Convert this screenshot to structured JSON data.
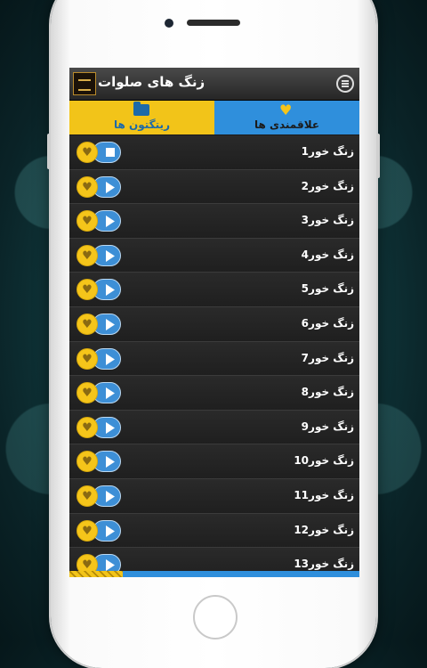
{
  "app": {
    "title": "زنگ های صلوات"
  },
  "tabs": [
    {
      "label": "ریتگتون ها",
      "icon": "folder-icon",
      "color": "#f2c419"
    },
    {
      "label": "علاقمندی ها",
      "icon": "heart-icon",
      "color": "#2f8fdc"
    }
  ],
  "ringtones": [
    {
      "label": "زنگ خور1",
      "state": "playing"
    },
    {
      "label": "زنگ خور2",
      "state": "stopped"
    },
    {
      "label": "زنگ خور3",
      "state": "stopped"
    },
    {
      "label": "زنگ خور4",
      "state": "stopped"
    },
    {
      "label": "زنگ خور5",
      "state": "stopped"
    },
    {
      "label": "زنگ خور6",
      "state": "stopped"
    },
    {
      "label": "زنگ خور7",
      "state": "stopped"
    },
    {
      "label": "زنگ خور8",
      "state": "stopped"
    },
    {
      "label": "زنگ خور9",
      "state": "stopped"
    },
    {
      "label": "زنگ خور10",
      "state": "stopped"
    },
    {
      "label": "زنگ خور11",
      "state": "stopped"
    },
    {
      "label": "زنگ خور12",
      "state": "stopped"
    },
    {
      "label": "زنگ خور13",
      "state": "stopped"
    }
  ],
  "colors": {
    "accent_yellow": "#f2c419",
    "accent_blue": "#2f8fdc",
    "row_bg": "#242424"
  }
}
